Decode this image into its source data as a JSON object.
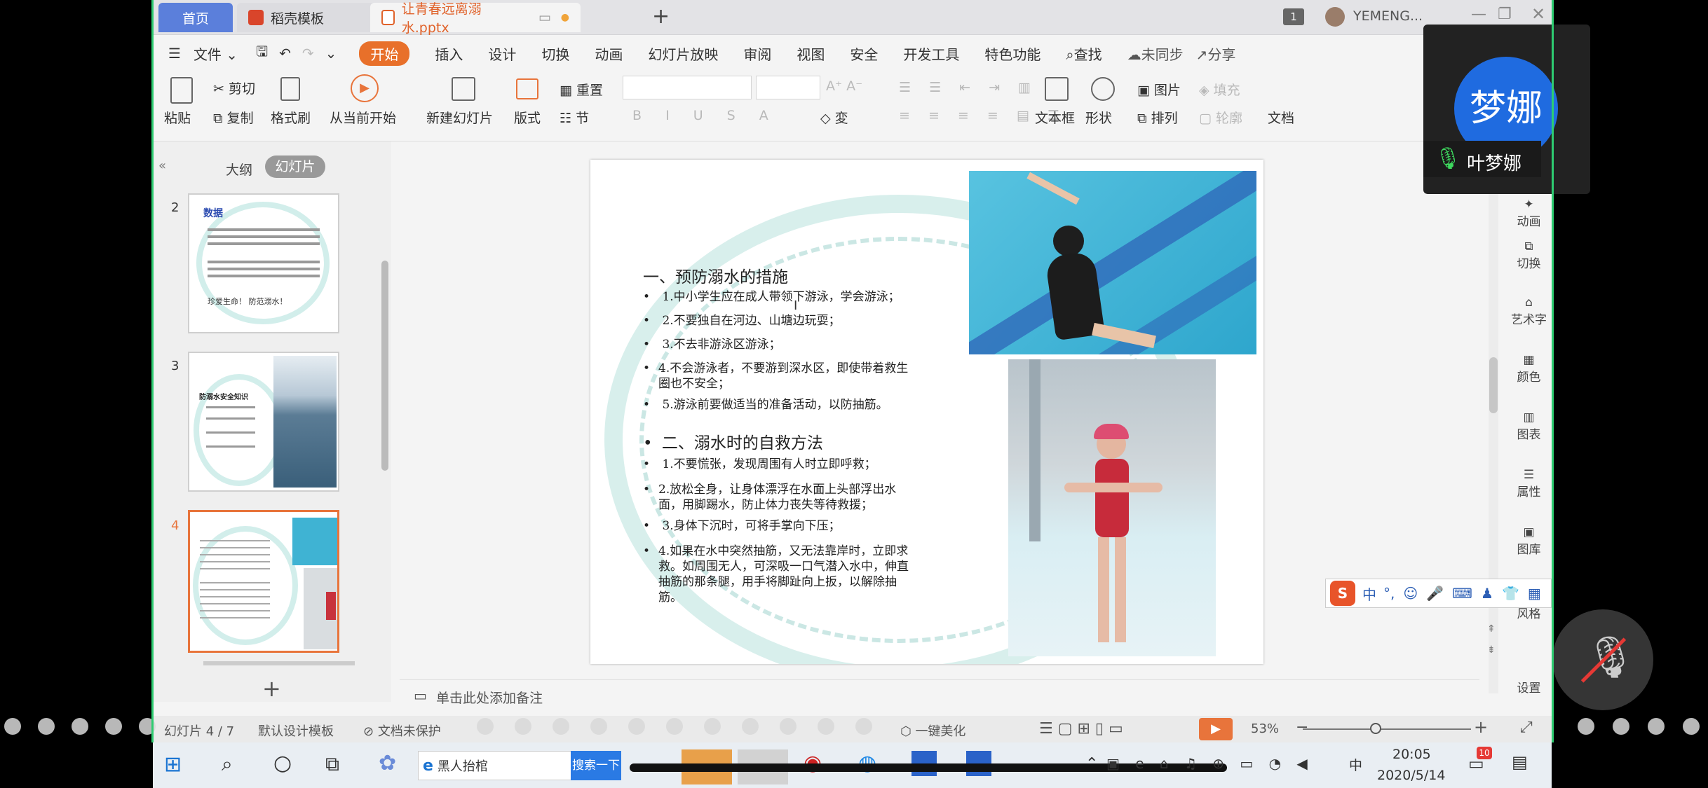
{
  "tabs": {
    "home": "首页",
    "template": "稻壳模板",
    "doc": "让青春远离溺水.pptx"
  },
  "window": {
    "badge": "1",
    "user": "YEMENG..."
  },
  "menu": [
    "文件",
    "开始",
    "插入",
    "设计",
    "切换",
    "动画",
    "幻灯片放映",
    "审阅",
    "视图",
    "安全",
    "开发工具",
    "特色功能",
    "查找",
    "未同步",
    "分享"
  ],
  "ribbon": {
    "paste": "粘贴",
    "cut": "剪切",
    "copy": "复制",
    "format_painter": "格式刷",
    "play_from_current": "从当前开始",
    "new_slide": "新建幻灯片",
    "layout": "版式",
    "reset": "重置",
    "section": "节",
    "text_box": "文本框",
    "shape": "形状",
    "picture": "图片",
    "fill": "填充",
    "arrange": "排列",
    "outline": "轮廓",
    "doc_partial": "文档"
  },
  "left_panel": {
    "outline_tab": "大纲",
    "slides_tab": "幻灯片",
    "slide_numbers": [
      "2",
      "3",
      "4"
    ],
    "thumb2_title": "数据",
    "thumb2_tail": "珍爱生命！ 防范溺水！",
    "thumb3_title": "防溺水安全知识"
  },
  "slide": {
    "heading1": "一、预防溺水的措施",
    "items1": [
      "1.中小学生应在成人带领下游泳，学会游泳；",
      "2.不要独自在河边、山塘边玩耍；",
      "3.不去非游泳区游泳；",
      "4.不会游泳者，不要游到深水区，即使带着救生圈也不安全；",
      "5.游泳前要做适当的准备活动，以防抽筋。"
    ],
    "heading2": "二、溺水时的自救方法",
    "items2": [
      "1.不要慌张，发现周围有人时立即呼救；",
      "2.放松全身，让身体漂浮在水面上头部浮出水面，用脚踢水，防止体力丧失等待救援；",
      "3.身体下沉时，可将手掌向下压；",
      "4.如果在水中突然抽筋，又无法靠岸时，立即求救。如周围无人，可深吸一口气潜入水中，伸直抽筋的那条腿，用手将脚趾向上扳，以解除抽筋。"
    ]
  },
  "notes_placeholder": "单击此处添加备注",
  "right_tools": [
    "动画",
    "切换",
    "艺术字",
    "颜色",
    "图表",
    "属性",
    "图库",
    "风格",
    "设置"
  ],
  "status": {
    "slide_count": "幻灯片 4 / 7",
    "theme": "默认设计模板",
    "doc_protect": "文档未保护",
    "beautify": "一键美化",
    "zoom": "53%"
  },
  "ime": {
    "lang": "中",
    "punct": "°,"
  },
  "taskbar": {
    "app": "黑人抬棺",
    "search_btn": "搜索一下",
    "time": "20:05",
    "date": "2020/5/14",
    "notif": "10",
    "ime_lang": "中"
  },
  "meeting": {
    "avatar": "梦娜",
    "name": "叶梦娜"
  }
}
